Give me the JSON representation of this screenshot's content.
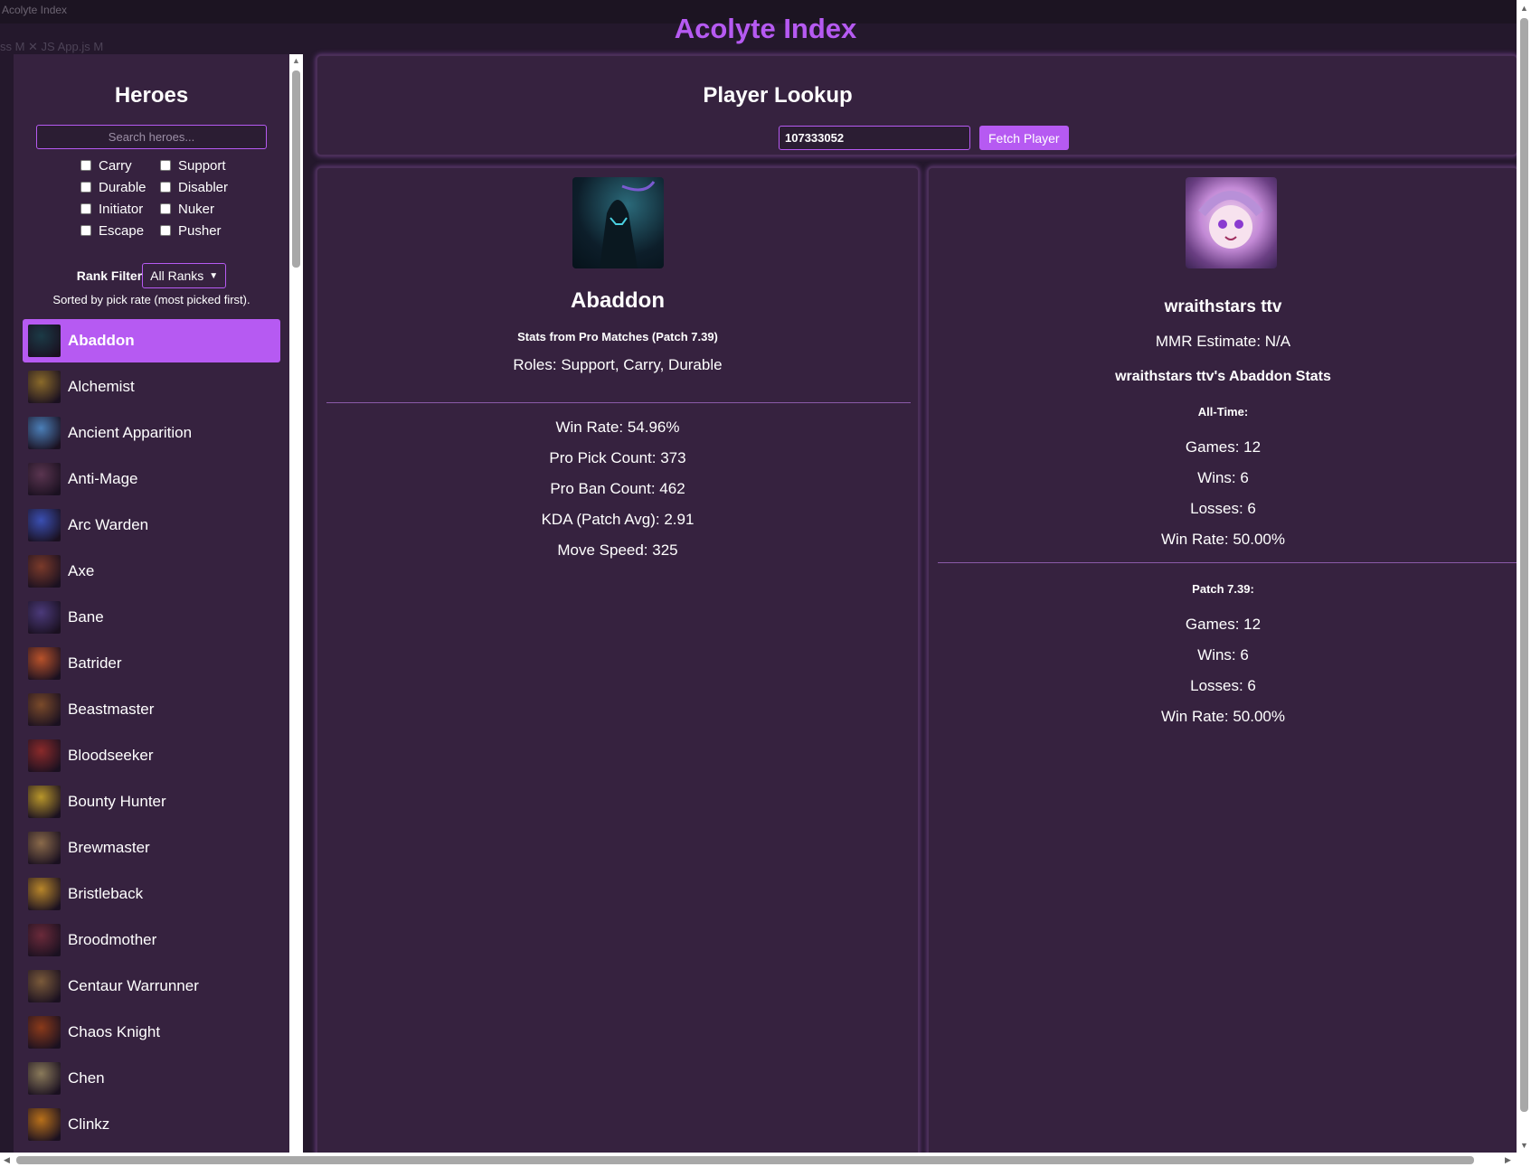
{
  "window": {
    "title": "Acolyte Index",
    "tabs": "ss M  ✕    JS App.js  M"
  },
  "app": {
    "title": "Acolyte Index"
  },
  "sidebar": {
    "heading": "Heroes",
    "search_placeholder": "Search heroes...",
    "roles": [
      "Carry",
      "Support",
      "Durable",
      "Disabler",
      "Initiator",
      "Nuker",
      "Escape",
      "Pusher"
    ],
    "rank_label": "Rank Filter",
    "rank_value": "All Ranks",
    "sort_note": "Sorted by pick rate (most picked first).",
    "heroes": [
      {
        "name": "Abaddon",
        "active": true,
        "color": "#1b3a46"
      },
      {
        "name": "Alchemist",
        "color": "#8a6a2a"
      },
      {
        "name": "Ancient Apparition",
        "color": "#4b7fb8"
      },
      {
        "name": "Anti-Mage",
        "color": "#5a3550"
      },
      {
        "name": "Arc Warden",
        "color": "#3a4fb2"
      },
      {
        "name": "Axe",
        "color": "#7a3a2a"
      },
      {
        "name": "Bane",
        "color": "#4b3a7a"
      },
      {
        "name": "Batrider",
        "color": "#b8522a"
      },
      {
        "name": "Beastmaster",
        "color": "#7a4a2a"
      },
      {
        "name": "Bloodseeker",
        "color": "#8a2a2a"
      },
      {
        "name": "Bounty Hunter",
        "color": "#b8962a"
      },
      {
        "name": "Brewmaster",
        "color": "#8a6a4a"
      },
      {
        "name": "Bristleback",
        "color": "#b8862a"
      },
      {
        "name": "Broodmother",
        "color": "#6a2a3a"
      },
      {
        "name": "Centaur Warrunner",
        "color": "#7a5a3a"
      },
      {
        "name": "Chaos Knight",
        "color": "#8a3a1a"
      },
      {
        "name": "Chen",
        "color": "#8a7a5a"
      },
      {
        "name": "Clinkz",
        "color": "#b8701a"
      }
    ]
  },
  "lookup": {
    "heading": "Player Lookup",
    "player_id": "107333052",
    "fetch_label": "Fetch Player"
  },
  "hero_panel": {
    "name": "Abaddon",
    "source": "Stats from Pro Matches (Patch 7.39)",
    "roles": "Roles: Support, Carry, Durable",
    "stats": [
      "Win Rate: 54.96%",
      "Pro Pick Count: 373",
      "Pro Ban Count: 462",
      "KDA (Patch Avg): 2.91",
      "Move Speed: 325"
    ]
  },
  "player_panel": {
    "name": "wraithstars ttv",
    "mmr": "MMR Estimate: N/A",
    "stats_heading": "wraithstars ttv's Abaddon Stats",
    "alltime_label": "All-Time:",
    "alltime": [
      "Games: 12",
      "Wins: 6",
      "Losses: 6",
      "Win Rate: 50.00%"
    ],
    "patch_label": "Patch 7.39:",
    "patch": [
      "Games: 12",
      "Wins: 6",
      "Losses: 6",
      "Win Rate: 50.00%"
    ]
  },
  "colors": {
    "accent": "#b65af2",
    "panel": "#36223f",
    "background": "#24182c"
  }
}
